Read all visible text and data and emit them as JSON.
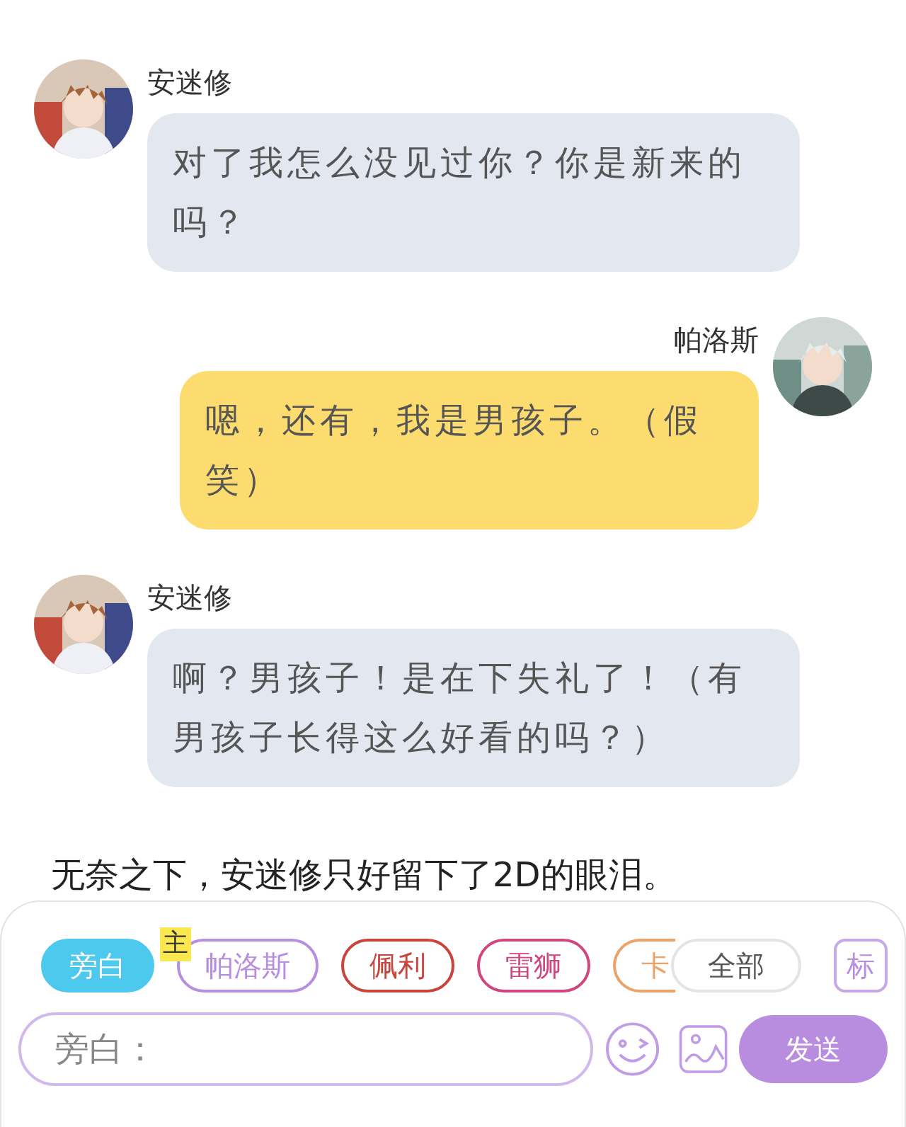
{
  "messages": [
    {
      "kind": "left",
      "name": "安迷修",
      "text": "对了我怎么没见过你？你是新来的吗？"
    },
    {
      "kind": "right",
      "name": "帕洛斯",
      "text": "嗯，还有，我是男孩子。（假笑）"
    },
    {
      "kind": "left",
      "name": "安迷修",
      "text": "啊？男孩子！是在下失礼了！（有男孩子长得这么好看的吗？）"
    },
    {
      "kind": "narration",
      "text": "无奈之下，安迷修只好留下了2D的眼泪。"
    }
  ],
  "characters": [
    {
      "label": "旁白",
      "color": "#4cc9ec",
      "selected": true
    },
    {
      "label": "帕洛斯",
      "color": "#b78ee0",
      "selected": false,
      "badge": "主"
    },
    {
      "label": "佩利",
      "color": "#c8453d",
      "selected": false
    },
    {
      "label": "雷狮",
      "color": "#d0467f",
      "selected": false
    },
    {
      "label": "卡",
      "color": "#eba36a",
      "selected": false,
      "cut": true
    }
  ],
  "all_button": "全部",
  "mark_button": "标",
  "input": {
    "placeholder": "旁白："
  },
  "send_button": "发送"
}
